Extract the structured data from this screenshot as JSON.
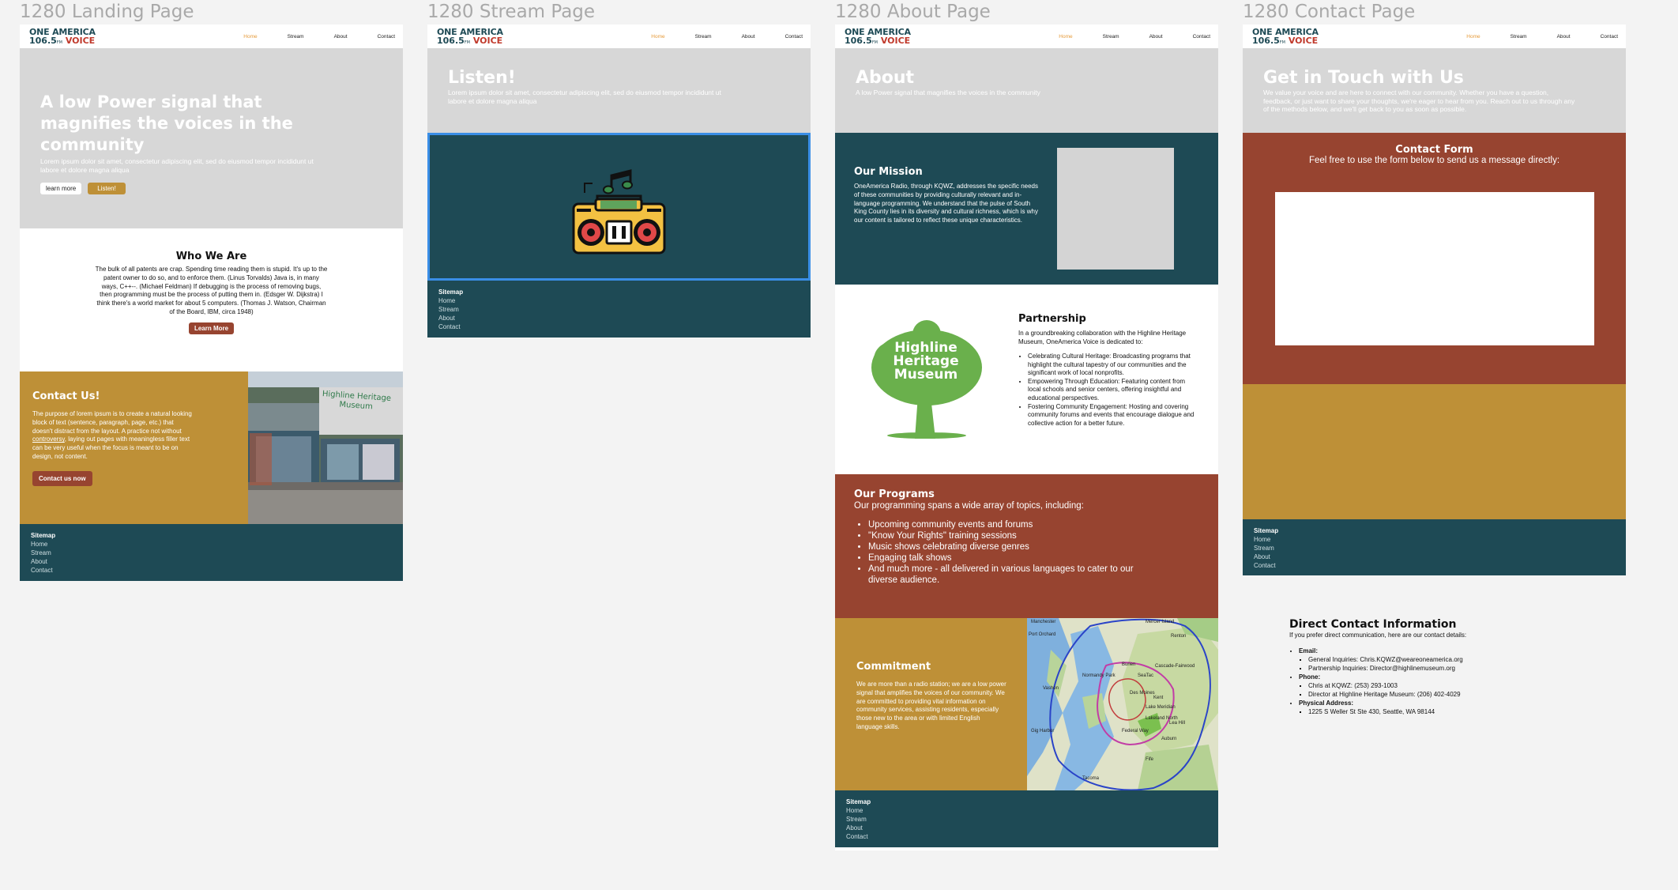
{
  "frames": {
    "landing": "1280 Landing Page",
    "stream": "1280 Stream Page",
    "about": "1280 About Page",
    "contact": "1280 Contact Page"
  },
  "logo": {
    "line1": "ONE AMERICA",
    "number": "106.5",
    "fm": "FM",
    "voice": "VOICE"
  },
  "nav": [
    "Home",
    "Stream",
    "About",
    "Contact"
  ],
  "colors": {
    "teal": "#1e4a55",
    "rust": "#974430",
    "gold": "#be9037",
    "hero_gray": "#d7d7d7",
    "nav_active": "#e69b3a",
    "selection": "#3a8ee6"
  },
  "footer": {
    "heading": "Sitemap",
    "links": [
      "Home",
      "Stream",
      "About",
      "Contact"
    ]
  },
  "landing": {
    "hero_title": "A low Power signal that magnifies the voices in the community",
    "hero_sub": "Lorem ipsum dolor sit amet, consectetur adipiscing elit, sed do eiusmod tempor incididunt ut labore et dolore magna aliqua",
    "btn_learn": "learn more",
    "btn_listen": "Listen!",
    "who_title": "Who We Are",
    "who_text": "The bulk of all patents are crap. Spending time reading them is stupid. It's up to the patent owner to do so, and to enforce them. (Linus Torvalds) Java is, in many ways, C++--. (Michael Feldman) If debugging is the process of removing bugs, then programming must be the process of putting them in. (Edsger W. Dijkstra) I think there's a world market for about 5 computers. (Thomas J. Watson, Chairman of the Board, IBM, circa 1948)",
    "who_btn": "Learn More",
    "contact_title": "Contact Us!",
    "contact_text_a": "The purpose of lorem ipsum is to create a natural looking block of text (sentence, paragraph, page, etc.) that doesn't distract from the layout. A practice not without ",
    "contact_text_link": "controversy",
    "contact_text_b": ", laying out pages with meaningless filler text can be very useful when the focus is meant to be on design, not content.",
    "contact_btn": "Contact us now",
    "sign_text": "Highline Heritage Museum"
  },
  "stream": {
    "title": "Listen!",
    "sub": "Lorem ipsum dolor sit amet, consectetur adipiscing elit, sed do eiusmod tempor incididunt ut labore et dolore magna aliqua",
    "player_icon": "boombox-icon"
  },
  "about": {
    "title": "About",
    "sub": "A low Power signal that magnifies the voices in the community",
    "mission_title": "Our Mission",
    "mission_text": "OneAmerica Radio, through KQWZ, addresses the specific needs of these communities by providing culturally relevant and in-language programming. We understand that the pulse of South King County lies in its diversity and cultural richness, which is why our content is tailored to reflect these unique characteristics.",
    "partner_logo": "Highline Heritage Museum",
    "partner_title": "Partnership",
    "partner_intro": "In a groundbreaking collaboration with the Highline Heritage Museum, OneAmerica Voice is dedicated to:",
    "partner_items": [
      "Celebrating Cultural Heritage: Broadcasting programs that highlight the cultural tapestry of our communities and the significant work of local nonprofits.",
      "Empowering Through Education: Featuring content from local schools and senior centers, offering insightful and educational perspectives.",
      "Fostering Community Engagement: Hosting and covering community forums and events that encourage dialogue and collective action for a better future."
    ],
    "programs_title": "Our Programs",
    "programs_intro": "Our programming spans a wide array of topics, including:",
    "programs_items": [
      "Upcoming community events and forums",
      "\"Know Your Rights\" training sessions",
      "Music shows celebrating diverse genres",
      "Engaging talk shows",
      "And much more - all delivered in various languages to cater to our diverse audience."
    ],
    "commit_title": "Commitment",
    "commit_text": "We are more than a radio station; we are a low power signal that amplifies the voices of our community. We are committed to providing vital information on community services, assisting residents, especially those new to the area or with limited English language skills.",
    "map_places": [
      "Manchester",
      "Port Orchard",
      "Mercer Island",
      "Renton",
      "Burien",
      "Normandy Park",
      "SeaTac",
      "Cascade-Fairwood",
      "Des Moines",
      "Kent",
      "Lake Meridian",
      "Lakeland North",
      "Federal Way",
      "Auburn",
      "Vashon",
      "Gig Harbor",
      "Tacoma",
      "Fife",
      "Lea Hill"
    ]
  },
  "contact": {
    "title": "Get in Touch with Us",
    "sub": "We value your voice and are here to connect with our community. Whether you have a question, feedback, or just want to share your thoughts, we're eager to hear from you. Reach out to us through any of the methods below, and we'll get back to you as soon as possible.",
    "form_title": "Contact Form",
    "form_sub": "Feel free to use the form below to send us a message directly:",
    "direct_title": "Direct Contact Information",
    "direct_intro": "If you prefer direct communication, here are our contact details:",
    "email_label": "Email",
    "email_items": [
      "General Inquiries: Chris.KQWZ@weareoneamerica.org",
      "Partnership Inquiries: Director@highlinemuseum.org"
    ],
    "phone_label": "Phone",
    "phone_items": [
      "Chris at KQWZ: (253) 293-1003",
      "Director at Highline Heritage Museum: (206) 402-4029"
    ],
    "address_label": "Physical Address",
    "address_items": [
      "1225 S Weller St Ste 430, Seattle, WA 98144"
    ]
  }
}
